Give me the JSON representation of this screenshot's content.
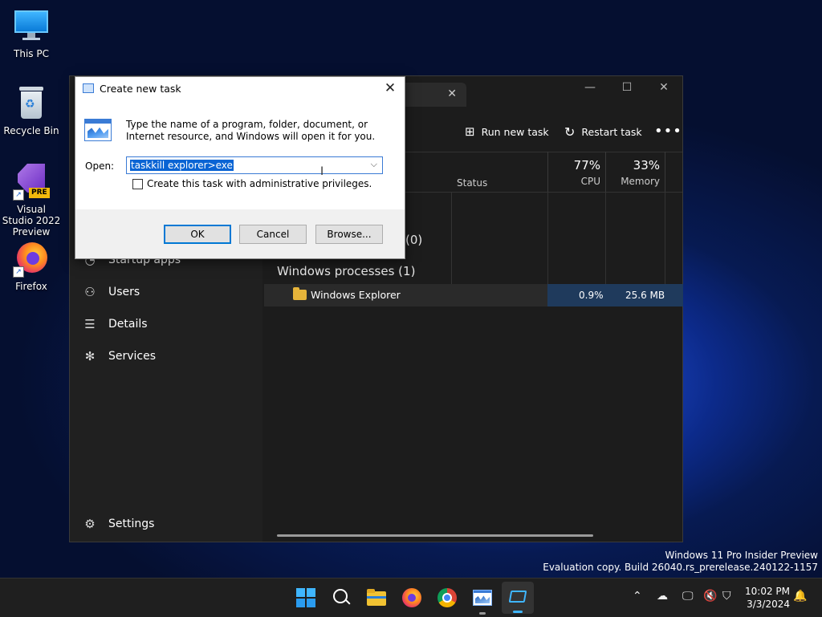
{
  "desktop": {
    "icons": [
      {
        "label": "This PC",
        "icon": "monitor-icon"
      },
      {
        "label": "Recycle Bin",
        "icon": "recycle-bin-icon"
      },
      {
        "label": "Visual Studio 2022 Preview",
        "icon": "visual-studio-icon",
        "badge": "PRE"
      },
      {
        "label": "Firefox",
        "icon": "firefox-icon"
      }
    ]
  },
  "task_manager": {
    "commands": {
      "run_new_task": "Run new task",
      "restart_task": "Restart task",
      "more": "•••"
    },
    "columns": {
      "status": "Status",
      "cpu_pct": "77%",
      "cpu": "CPU",
      "memory_pct": "33%",
      "memory": "Memory"
    },
    "sidebar": {
      "items": [
        {
          "label": "Startup apps",
          "icon": "startup-icon"
        },
        {
          "label": "Users",
          "icon": "users-icon"
        },
        {
          "label": "Details",
          "icon": "details-list-icon"
        },
        {
          "label": "Services",
          "icon": "services-puzzle-icon"
        }
      ],
      "settings": "Settings"
    },
    "partial_group_count": "(0)",
    "group": "Windows processes (1)",
    "process": {
      "name": "Windows Explorer",
      "cpu": "0.9%",
      "memory": "25.6 MB"
    }
  },
  "run_dialog": {
    "title": "Create new task",
    "description": "Type the name of a program, folder, document, or Internet resource, and Windows will open it for you.",
    "open_label": "Open:",
    "open_value": "taskkill explorer>exe",
    "admin_checkbox": "Create this task with administrative privileges.",
    "ok": "OK",
    "cancel": "Cancel",
    "browse": "Browse..."
  },
  "watermark": {
    "line1": "Windows 11 Pro Insider Preview",
    "line2": "Evaluation copy. Build 26040.rs_prerelease.240122-1157"
  },
  "taskbar": {
    "time": "10:02 PM",
    "date": "3/3/2024"
  },
  "colors": {
    "accent": "#0078d4",
    "selection": "#0a64d4"
  }
}
